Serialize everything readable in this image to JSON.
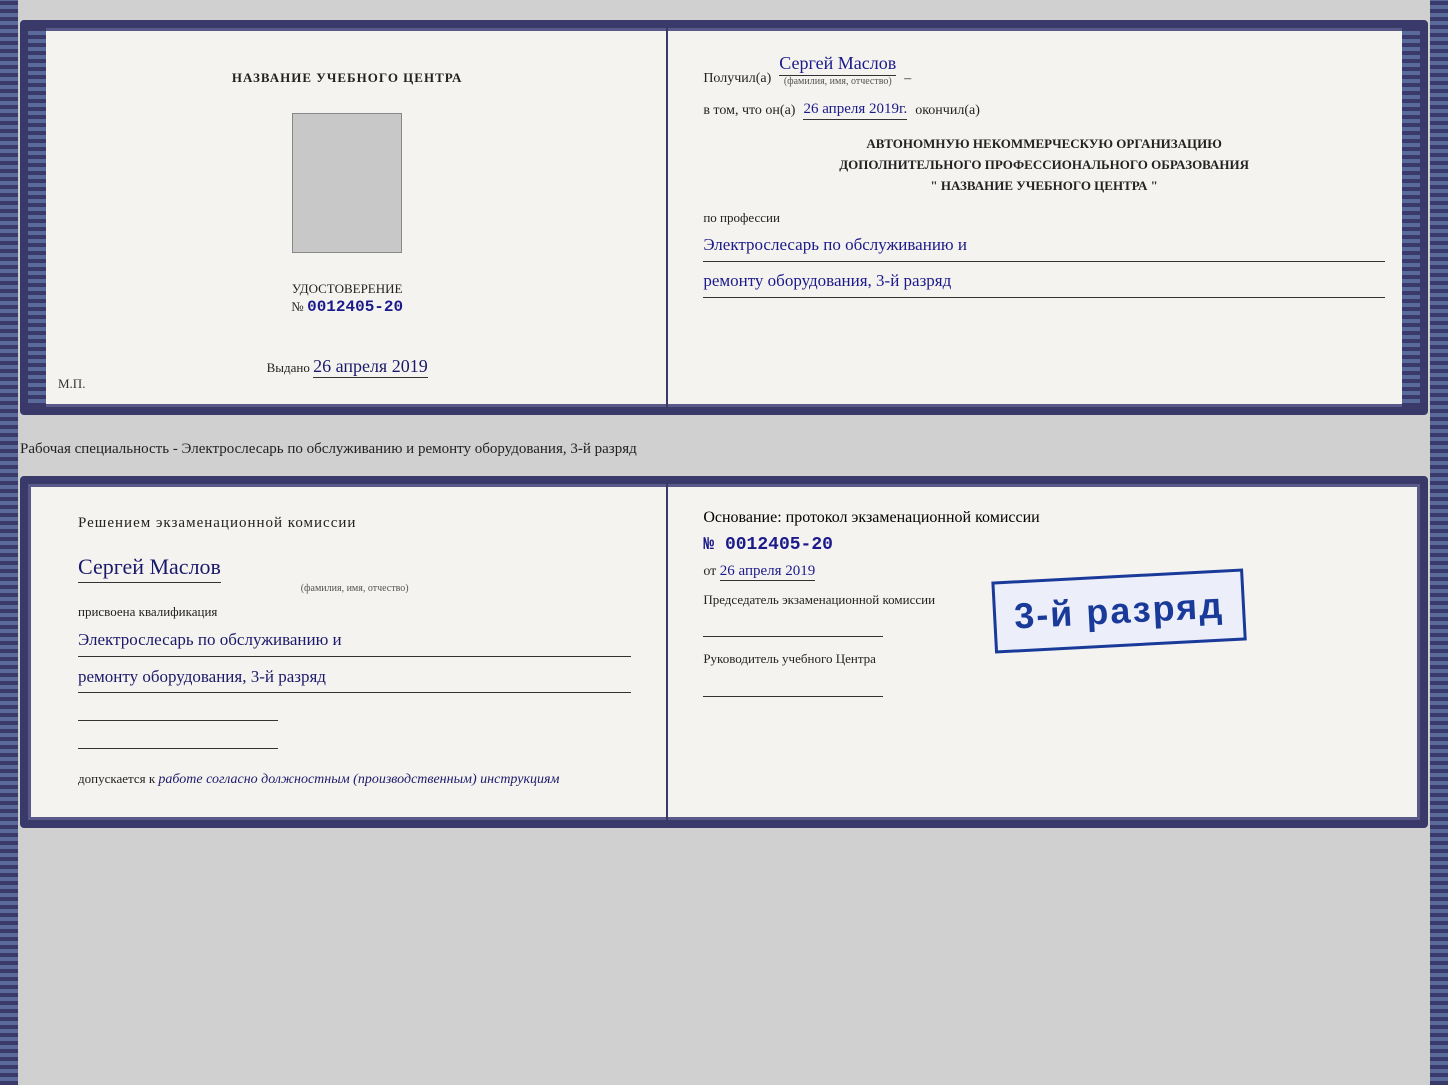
{
  "card1": {
    "left": {
      "title_line1": "НАЗВАНИЕ УЧЕБНОГО ЦЕНТРА",
      "cert_label": "УДОСТОВЕРЕНИЕ",
      "cert_number_prefix": "№",
      "cert_number": "0012405-20",
      "issued_label": "Выдано",
      "issued_date": "26 апреля 2019",
      "mp_label": "М.П."
    },
    "right": {
      "received_label": "Получил(а)",
      "recipient_name": "Сергей Маслов",
      "fio_subtitle": "(фамилия, имя, отчество)",
      "in_that_label": "в том, что он(а)",
      "completed_date": "26 апреля 2019г.",
      "completed_label": "окончил(а)",
      "org_line1": "АВТОНОМНУЮ НЕКОММЕРЧЕСКУЮ ОРГАНИЗАЦИЮ",
      "org_line2": "ДОПОЛНИТЕЛЬНОГО ПРОФЕССИОНАЛЬНОГО ОБРАЗОВАНИЯ",
      "org_quote1": "\"",
      "org_name": "НАЗВАНИЕ УЧЕБНОГО ЦЕНТРА",
      "org_quote2": "\"",
      "profession_label": "по профессии",
      "profession_text1": "Электрослесарь по обслуживанию и",
      "profession_text2": "ремонту оборудования, 3-й разряд"
    }
  },
  "specialty_label": "Рабочая специальность - Электрослесарь по обслуживанию и ремонту оборудования, 3-й разряд",
  "card2": {
    "left": {
      "title": "Решением экзаменационной комиссии",
      "name": "Сергей Маслов",
      "fio_subtitle": "(фамилия, имя, отчество)",
      "assigned_label": "присвоена квалификация",
      "qualification1": "Электрослесарь по обслуживанию и",
      "qualification2": "ремонту оборудования, 3-й разряд",
      "допуск_label": "допускается к",
      "допуск_text": "работе согласно должностным (производственным) инструкциям"
    },
    "right": {
      "osnowanie_label": "Основание: протокол экзаменационной комиссии",
      "number_prefix": "№",
      "number_value": "0012405-20",
      "date_prefix": "от",
      "date_value": "26 апреля 2019",
      "chairman_label": "Председатель экзаменационной комиссии",
      "rukov_label": "Руководитель учебного Центра"
    },
    "stamp": {
      "line1": "3-й разряд"
    }
  }
}
